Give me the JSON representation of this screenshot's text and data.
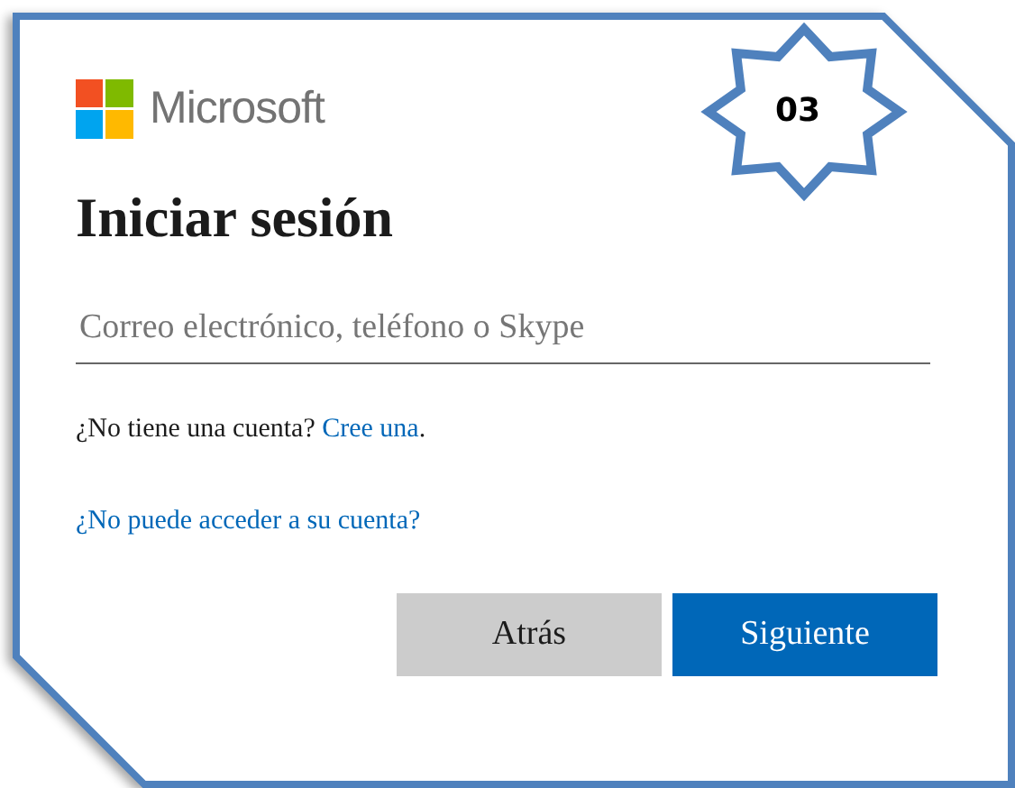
{
  "badge": "03",
  "logo": {
    "text": "Microsoft"
  },
  "title": "Iniciar sesión",
  "email_field": {
    "placeholder": "Correo electrónico, teléfono o Skype"
  },
  "signup_prompt": {
    "text": "¿No tiene una cuenta?",
    "link": "Cree una",
    "end": "."
  },
  "help_link": "¿No puede acceder a su cuenta?",
  "buttons": [
    {
      "label": "Atrás",
      "kind": "secondary"
    },
    {
      "label": "Siguiente",
      "kind": "primary"
    }
  ]
}
